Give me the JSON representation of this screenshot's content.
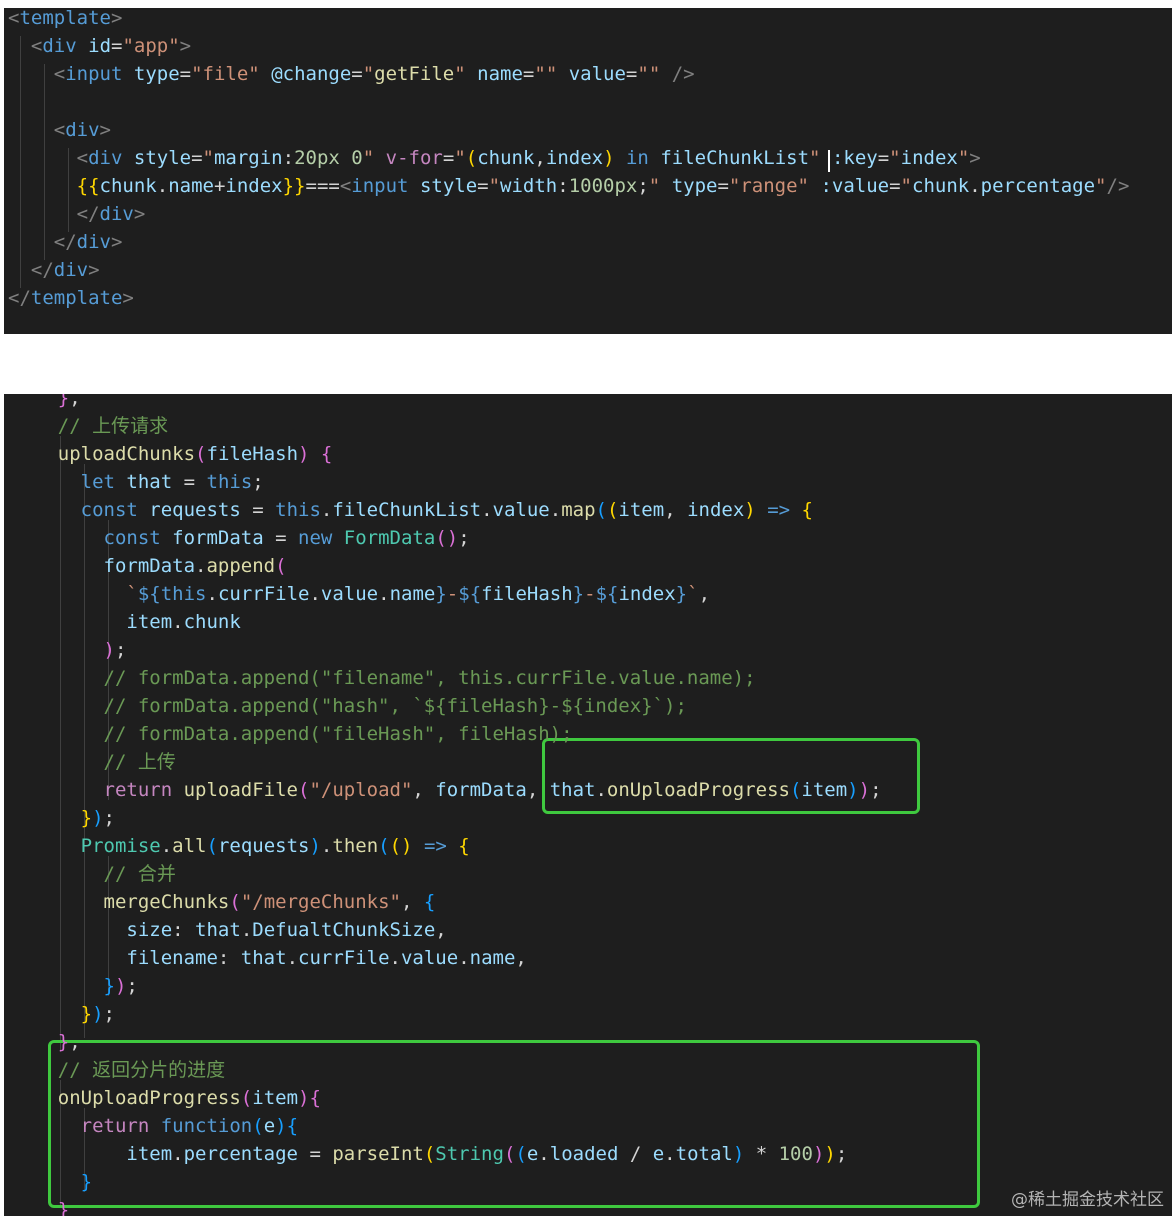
{
  "colors": {
    "editor_background": "#1e1e1e",
    "highlight_box": "#3fc93f",
    "page_background": "#ffffff"
  },
  "template_panel": {
    "lines": [
      [
        [
          "t-br",
          "<"
        ],
        [
          "t-tag",
          "template"
        ],
        [
          "t-br",
          ">"
        ]
      ],
      [
        [
          "t-txt",
          "  "
        ],
        [
          "t-br",
          "<"
        ],
        [
          "t-tag",
          "div"
        ],
        [
          "t-txt",
          " "
        ],
        [
          "t-attr",
          "id"
        ],
        [
          "t-txt",
          "="
        ],
        [
          "t-str",
          "\"app\""
        ],
        [
          "t-br",
          ">"
        ]
      ],
      [
        [
          "t-txt",
          "    "
        ],
        [
          "t-br",
          "<"
        ],
        [
          "t-tag",
          "input"
        ],
        [
          "t-txt",
          " "
        ],
        [
          "t-attr",
          "type"
        ],
        [
          "t-txt",
          "="
        ],
        [
          "t-str",
          "\"file\""
        ],
        [
          "t-txt",
          " "
        ],
        [
          "t-attr",
          "@change"
        ],
        [
          "t-txt",
          "="
        ],
        [
          "t-str",
          "\""
        ],
        [
          "t-fn",
          "getFile"
        ],
        [
          "t-str",
          "\""
        ],
        [
          "t-txt",
          " "
        ],
        [
          "t-attr",
          "name"
        ],
        [
          "t-txt",
          "="
        ],
        [
          "t-str",
          "\"\""
        ],
        [
          "t-txt",
          " "
        ],
        [
          "t-attr",
          "value"
        ],
        [
          "t-txt",
          "="
        ],
        [
          "t-str",
          "\"\""
        ],
        [
          "t-txt",
          " "
        ],
        [
          "t-br",
          "/>"
        ]
      ],
      [
        [
          "t-txt",
          ""
        ]
      ],
      [
        [
          "t-txt",
          "    "
        ],
        [
          "t-br",
          "<"
        ],
        [
          "t-tag",
          "div"
        ],
        [
          "t-br",
          ">"
        ]
      ],
      [
        [
          "t-txt",
          "      "
        ],
        [
          "t-br",
          "<"
        ],
        [
          "t-tag",
          "div"
        ],
        [
          "t-txt",
          " "
        ],
        [
          "t-attr",
          "style"
        ],
        [
          "t-txt",
          "="
        ],
        [
          "t-str",
          "\""
        ],
        [
          "t-attr",
          "margin"
        ],
        [
          "t-txt",
          ":"
        ],
        [
          "t-num",
          "20px"
        ],
        [
          "t-txt",
          " "
        ],
        [
          "t-num",
          "0"
        ],
        [
          "t-str",
          "\""
        ],
        [
          "t-txt",
          " "
        ],
        [
          "t-ctl",
          "v-for"
        ],
        [
          "t-txt",
          "="
        ],
        [
          "t-str",
          "\""
        ],
        [
          "t-b1",
          "("
        ],
        [
          "t-var",
          "chunk"
        ],
        [
          "t-txt",
          ","
        ],
        [
          "t-var",
          "index"
        ],
        [
          "t-b1",
          ")"
        ],
        [
          "t-txt",
          " "
        ],
        [
          "t-kw",
          "in"
        ],
        [
          "t-txt",
          " "
        ],
        [
          "t-var",
          "fileChunkList"
        ],
        [
          "t-str",
          "\""
        ],
        [
          "t-txt",
          " "
        ],
        [
          "t-attr",
          ":key"
        ],
        [
          "t-txt",
          "="
        ],
        [
          "t-str",
          "\""
        ],
        [
          "t-var",
          "index"
        ],
        [
          "t-str",
          "\""
        ],
        [
          "t-br",
          ">"
        ]
      ],
      [
        [
          "t-txt",
          "      "
        ],
        [
          "t-b1",
          "{{"
        ],
        [
          "t-var",
          "chunk"
        ],
        [
          "t-txt",
          "."
        ],
        [
          "t-var",
          "name"
        ],
        [
          "t-txt",
          "+"
        ],
        [
          "t-var",
          "index"
        ],
        [
          "t-b1",
          "}}"
        ],
        [
          "t-txt",
          "==="
        ],
        [
          "t-br",
          "<"
        ],
        [
          "t-tag",
          "input"
        ],
        [
          "t-txt",
          " "
        ],
        [
          "t-attr",
          "style"
        ],
        [
          "t-txt",
          "="
        ],
        [
          "t-str",
          "\""
        ],
        [
          "t-attr",
          "width"
        ],
        [
          "t-txt",
          ":"
        ],
        [
          "t-num",
          "1000px"
        ],
        [
          "t-txt",
          ";"
        ],
        [
          "t-str",
          "\""
        ],
        [
          "t-txt",
          " "
        ],
        [
          "t-attr",
          "type"
        ],
        [
          "t-txt",
          "="
        ],
        [
          "t-str",
          "\"range\""
        ],
        [
          "t-txt",
          " "
        ],
        [
          "t-attr",
          ":value"
        ],
        [
          "t-txt",
          "="
        ],
        [
          "t-str",
          "\""
        ],
        [
          "t-var",
          "chunk"
        ],
        [
          "t-txt",
          "."
        ],
        [
          "t-var",
          "percentage"
        ],
        [
          "t-str",
          "\""
        ],
        [
          "t-br",
          "/>"
        ]
      ],
      [
        [
          "t-txt",
          "      "
        ],
        [
          "t-br",
          "</"
        ],
        [
          "t-tag",
          "div"
        ],
        [
          "t-br",
          ">"
        ]
      ],
      [
        [
          "t-txt",
          "    "
        ],
        [
          "t-br",
          "</"
        ],
        [
          "t-tag",
          "div"
        ],
        [
          "t-br",
          ">"
        ]
      ],
      [
        [
          "t-txt",
          "  "
        ],
        [
          "t-br",
          "</"
        ],
        [
          "t-tag",
          "div"
        ],
        [
          "t-br",
          ">"
        ]
      ],
      [
        [
          "t-br",
          "</"
        ],
        [
          "t-tag",
          "template"
        ],
        [
          "t-br",
          ">"
        ]
      ]
    ]
  },
  "script_panel": {
    "lines": [
      [
        [
          "t-txt",
          "    "
        ],
        [
          "t-b2",
          "}"
        ],
        [
          "t-txt",
          ","
        ]
      ],
      [
        [
          "t-txt",
          "    "
        ],
        [
          "t-cmt",
          "// 上传请求"
        ]
      ],
      [
        [
          "t-txt",
          "    "
        ],
        [
          "t-fn",
          "uploadChunks"
        ],
        [
          "t-b2",
          "("
        ],
        [
          "t-var",
          "fileHash"
        ],
        [
          "t-b2",
          ")"
        ],
        [
          "t-txt",
          " "
        ],
        [
          "t-b2",
          "{"
        ]
      ],
      [
        [
          "t-txt",
          "      "
        ],
        [
          "t-kw",
          "let"
        ],
        [
          "t-txt",
          " "
        ],
        [
          "t-var",
          "that"
        ],
        [
          "t-txt",
          " = "
        ],
        [
          "t-kw",
          "this"
        ],
        [
          "t-txt",
          ";"
        ]
      ],
      [
        [
          "t-txt",
          "      "
        ],
        [
          "t-kw",
          "const"
        ],
        [
          "t-txt",
          " "
        ],
        [
          "t-var",
          "requests"
        ],
        [
          "t-txt",
          " = "
        ],
        [
          "t-kw",
          "this"
        ],
        [
          "t-txt",
          "."
        ],
        [
          "t-var",
          "fileChunkList"
        ],
        [
          "t-txt",
          "."
        ],
        [
          "t-var",
          "value"
        ],
        [
          "t-txt",
          "."
        ],
        [
          "t-fn",
          "map"
        ],
        [
          "t-b3",
          "("
        ],
        [
          "t-b1",
          "("
        ],
        [
          "t-var",
          "item"
        ],
        [
          "t-txt",
          ", "
        ],
        [
          "t-var",
          "index"
        ],
        [
          "t-b1",
          ")"
        ],
        [
          "t-txt",
          " "
        ],
        [
          "t-kw",
          "=>"
        ],
        [
          "t-txt",
          " "
        ],
        [
          "t-b1",
          "{"
        ]
      ],
      [
        [
          "t-txt",
          "        "
        ],
        [
          "t-kw",
          "const"
        ],
        [
          "t-txt",
          " "
        ],
        [
          "t-var",
          "formData"
        ],
        [
          "t-txt",
          " = "
        ],
        [
          "t-kw",
          "new"
        ],
        [
          "t-txt",
          " "
        ],
        [
          "t-cls",
          "FormData"
        ],
        [
          "t-b2",
          "()"
        ],
        [
          "t-txt",
          ";"
        ]
      ],
      [
        [
          "t-txt",
          "        "
        ],
        [
          "t-var",
          "formData"
        ],
        [
          "t-txt",
          "."
        ],
        [
          "t-fn",
          "append"
        ],
        [
          "t-b2",
          "("
        ]
      ],
      [
        [
          "t-txt",
          "          "
        ],
        [
          "t-str",
          "`"
        ],
        [
          "t-kw",
          "${"
        ],
        [
          "t-kw",
          "this"
        ],
        [
          "t-txt",
          "."
        ],
        [
          "t-var",
          "currFile"
        ],
        [
          "t-txt",
          "."
        ],
        [
          "t-var",
          "value"
        ],
        [
          "t-txt",
          "."
        ],
        [
          "t-var",
          "name"
        ],
        [
          "t-kw",
          "}"
        ],
        [
          "t-str",
          "-"
        ],
        [
          "t-kw",
          "${"
        ],
        [
          "t-var",
          "fileHash"
        ],
        [
          "t-kw",
          "}"
        ],
        [
          "t-str",
          "-"
        ],
        [
          "t-kw",
          "${"
        ],
        [
          "t-var",
          "index"
        ],
        [
          "t-kw",
          "}"
        ],
        [
          "t-str",
          "`"
        ],
        [
          "t-txt",
          ","
        ]
      ],
      [
        [
          "t-txt",
          "          "
        ],
        [
          "t-var",
          "item"
        ],
        [
          "t-txt",
          "."
        ],
        [
          "t-var",
          "chunk"
        ]
      ],
      [
        [
          "t-txt",
          "        "
        ],
        [
          "t-b2",
          ")"
        ],
        [
          "t-txt",
          ";"
        ]
      ],
      [
        [
          "t-txt",
          "        "
        ],
        [
          "t-cmt",
          "// formData.append(\"filename\", this.currFile.value.name);"
        ]
      ],
      [
        [
          "t-txt",
          "        "
        ],
        [
          "t-cmt",
          "// formData.append(\"hash\", `${fileHash}-${index}`);"
        ]
      ],
      [
        [
          "t-txt",
          "        "
        ],
        [
          "t-cmt",
          "// formData.append(\"fileHash\", fileHash);"
        ]
      ],
      [
        [
          "t-txt",
          "        "
        ],
        [
          "t-cmt",
          "// 上传"
        ]
      ],
      [
        [
          "t-txt",
          "        "
        ],
        [
          "t-ctl",
          "return"
        ],
        [
          "t-txt",
          " "
        ],
        [
          "t-fn",
          "uploadFile"
        ],
        [
          "t-b2",
          "("
        ],
        [
          "t-str",
          "\"/upload\""
        ],
        [
          "t-txt",
          ", "
        ],
        [
          "t-var",
          "formData"
        ],
        [
          "t-txt",
          ", "
        ],
        [
          "t-var",
          "that"
        ],
        [
          "t-txt",
          "."
        ],
        [
          "t-fn",
          "onUploadProgress"
        ],
        [
          "t-b3",
          "("
        ],
        [
          "t-var",
          "item"
        ],
        [
          "t-b3",
          ")"
        ],
        [
          "t-b2",
          ")"
        ],
        [
          "t-txt",
          ";"
        ]
      ],
      [
        [
          "t-txt",
          "      "
        ],
        [
          "t-b1",
          "}"
        ],
        [
          "t-b3",
          ")"
        ],
        [
          "t-txt",
          ";"
        ]
      ],
      [
        [
          "t-txt",
          "      "
        ],
        [
          "t-cls",
          "Promise"
        ],
        [
          "t-txt",
          "."
        ],
        [
          "t-fn",
          "all"
        ],
        [
          "t-b3",
          "("
        ],
        [
          "t-var",
          "requests"
        ],
        [
          "t-b3",
          ")"
        ],
        [
          "t-txt",
          "."
        ],
        [
          "t-fn",
          "then"
        ],
        [
          "t-b3",
          "("
        ],
        [
          "t-b1",
          "()"
        ],
        [
          "t-txt",
          " "
        ],
        [
          "t-kw",
          "=>"
        ],
        [
          "t-txt",
          " "
        ],
        [
          "t-b1",
          "{"
        ]
      ],
      [
        [
          "t-txt",
          "        "
        ],
        [
          "t-cmt",
          "// 合并"
        ]
      ],
      [
        [
          "t-txt",
          "        "
        ],
        [
          "t-fn",
          "mergeChunks"
        ],
        [
          "t-b2",
          "("
        ],
        [
          "t-str",
          "\"/mergeChunks\""
        ],
        [
          "t-txt",
          ", "
        ],
        [
          "t-b3",
          "{"
        ]
      ],
      [
        [
          "t-txt",
          "          "
        ],
        [
          "t-var",
          "size"
        ],
        [
          "t-txt",
          ": "
        ],
        [
          "t-var",
          "that"
        ],
        [
          "t-txt",
          "."
        ],
        [
          "t-var",
          "DefualtChunkSize"
        ],
        [
          "t-txt",
          ","
        ]
      ],
      [
        [
          "t-txt",
          "          "
        ],
        [
          "t-var",
          "filename"
        ],
        [
          "t-txt",
          ": "
        ],
        [
          "t-var",
          "that"
        ],
        [
          "t-txt",
          "."
        ],
        [
          "t-var",
          "currFile"
        ],
        [
          "t-txt",
          "."
        ],
        [
          "t-var",
          "value"
        ],
        [
          "t-txt",
          "."
        ],
        [
          "t-var",
          "name"
        ],
        [
          "t-txt",
          ","
        ]
      ],
      [
        [
          "t-txt",
          "        "
        ],
        [
          "t-b3",
          "}"
        ],
        [
          "t-b2",
          ")"
        ],
        [
          "t-txt",
          ";"
        ]
      ],
      [
        [
          "t-txt",
          "      "
        ],
        [
          "t-b1",
          "}"
        ],
        [
          "t-b3",
          ")"
        ],
        [
          "t-txt",
          ";"
        ]
      ],
      [
        [
          "t-txt",
          "    "
        ],
        [
          "t-b2",
          "}"
        ],
        [
          "t-txt",
          ","
        ]
      ],
      [
        [
          "t-txt",
          "    "
        ],
        [
          "t-cmt",
          "// 返回分片的进度"
        ]
      ],
      [
        [
          "t-txt",
          "    "
        ],
        [
          "t-fn",
          "onUploadProgress"
        ],
        [
          "t-b2",
          "("
        ],
        [
          "t-var",
          "item"
        ],
        [
          "t-b2",
          ")"
        ],
        [
          "t-b2",
          "{"
        ]
      ],
      [
        [
          "t-txt",
          "      "
        ],
        [
          "t-ctl",
          "return"
        ],
        [
          "t-txt",
          " "
        ],
        [
          "t-kw",
          "function"
        ],
        [
          "t-b3",
          "("
        ],
        [
          "t-var",
          "e"
        ],
        [
          "t-b3",
          ")"
        ],
        [
          "t-b3",
          "{"
        ]
      ],
      [
        [
          "t-txt",
          "          "
        ],
        [
          "t-var",
          "item"
        ],
        [
          "t-txt",
          "."
        ],
        [
          "t-var",
          "percentage"
        ],
        [
          "t-txt",
          " = "
        ],
        [
          "t-fn",
          "parseInt"
        ],
        [
          "t-b1",
          "("
        ],
        [
          "t-cls",
          "String"
        ],
        [
          "t-b2",
          "("
        ],
        [
          "t-b3",
          "("
        ],
        [
          "t-var",
          "e"
        ],
        [
          "t-txt",
          "."
        ],
        [
          "t-var",
          "loaded"
        ],
        [
          "t-txt",
          " / "
        ],
        [
          "t-var",
          "e"
        ],
        [
          "t-txt",
          "."
        ],
        [
          "t-var",
          "total"
        ],
        [
          "t-b3",
          ")"
        ],
        [
          "t-txt",
          " * "
        ],
        [
          "t-num",
          "100"
        ],
        [
          "t-b2",
          ")"
        ],
        [
          "t-b1",
          ")"
        ],
        [
          "t-txt",
          ";"
        ]
      ],
      [
        [
          "t-txt",
          "      "
        ],
        [
          "t-b3",
          "}"
        ]
      ],
      [
        [
          "t-txt",
          "    "
        ],
        [
          "t-b2",
          "}"
        ]
      ]
    ]
  },
  "watermark": "@稀土掘金技术社区"
}
